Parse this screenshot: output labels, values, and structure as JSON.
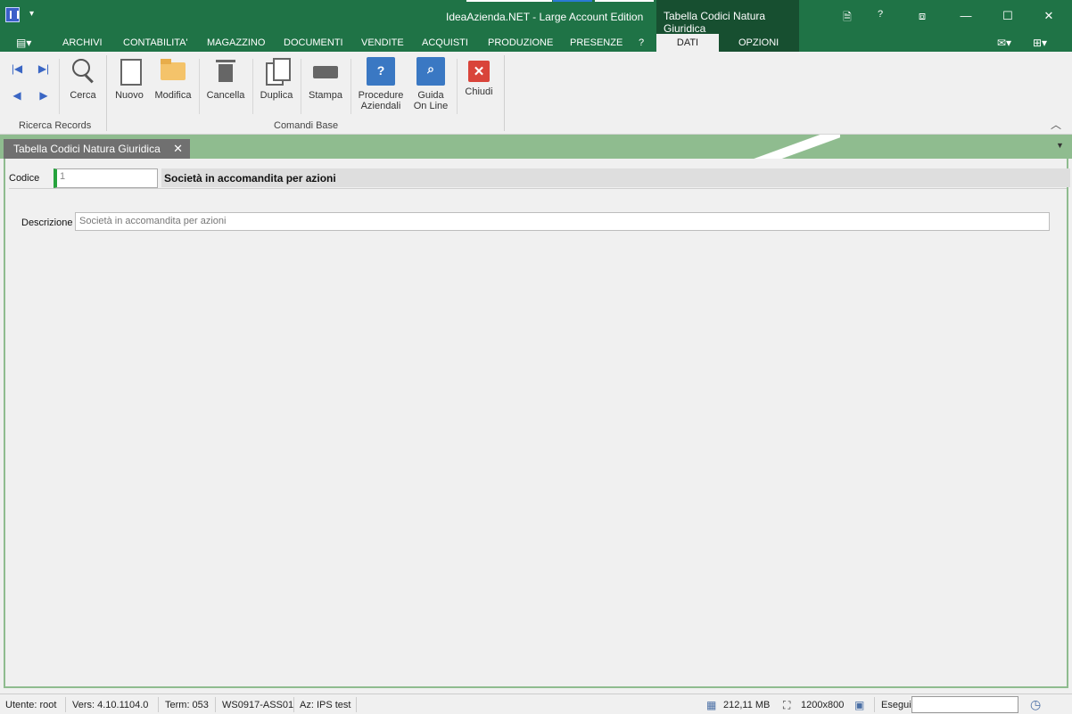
{
  "titlebar": {
    "title": "IdeaAzienda.NET - Large Account Edition",
    "context_tab": "Tabella Codici Natura Giuridica",
    "quick_access": "▾",
    "help": "?",
    "restore": "⧈",
    "minimize": "—",
    "maximize": "☐",
    "close": "✕"
  },
  "menu": {
    "file": "▤▾",
    "tabs": [
      "ARCHIVI",
      "CONTABILITA'",
      "MAGAZZINO",
      "DOCUMENTI",
      "VENDITE",
      "ACQUISTI",
      "PRODUZIONE",
      "PRESENZE",
      "?"
    ],
    "context_tabs": [
      "DATI",
      "OPZIONI"
    ],
    "active_tab": "DATI",
    "mail": "✉▾",
    "layout": "⊞▾"
  },
  "ribbon": {
    "nav": {
      "first": "|◀",
      "last": "▶|",
      "prev": "◀",
      "next": "▶"
    },
    "buttons": {
      "cerca": "Cerca",
      "nuovo": "Nuovo",
      "modifica": "Modifica",
      "cancella": "Cancella",
      "duplica": "Duplica",
      "stampa": "Stampa",
      "procedure_1": "Procedure",
      "procedure_2": "Aziendali",
      "guida_1": "Guida",
      "guida_2": "On Line",
      "chiudi": "Chiudi"
    },
    "groups": {
      "ricerca": "Ricerca Records",
      "comandi": "Comandi Base"
    },
    "collapse": "︿",
    "help_glyph": "?",
    "close_glyph": "✕"
  },
  "document_tab": {
    "label": "Tabella Codici Natura Giuridica",
    "close": "✕",
    "dropdown": "▼"
  },
  "form": {
    "codice_label": "Codice",
    "codice_value": "1",
    "codice_desc": "Società in accomandita per azioni",
    "descrizione_label": "Descrizione",
    "descrizione_value": "Società in accomandita per azioni"
  },
  "status": {
    "utente": "Utente: root",
    "versione": "Vers: 4.10.1104.0",
    "term": "Term: 053",
    "workstation": "WS0917-ASS01",
    "azienda": "Az: IPS test",
    "memory": "212,11 MB",
    "resolution": "1200x800",
    "esegui": "Esegui"
  },
  "colors": {
    "titlebar": "#1f7346",
    "context": "#174f30",
    "strip": "#8fbc8f",
    "accent_green": "#26a33d"
  }
}
